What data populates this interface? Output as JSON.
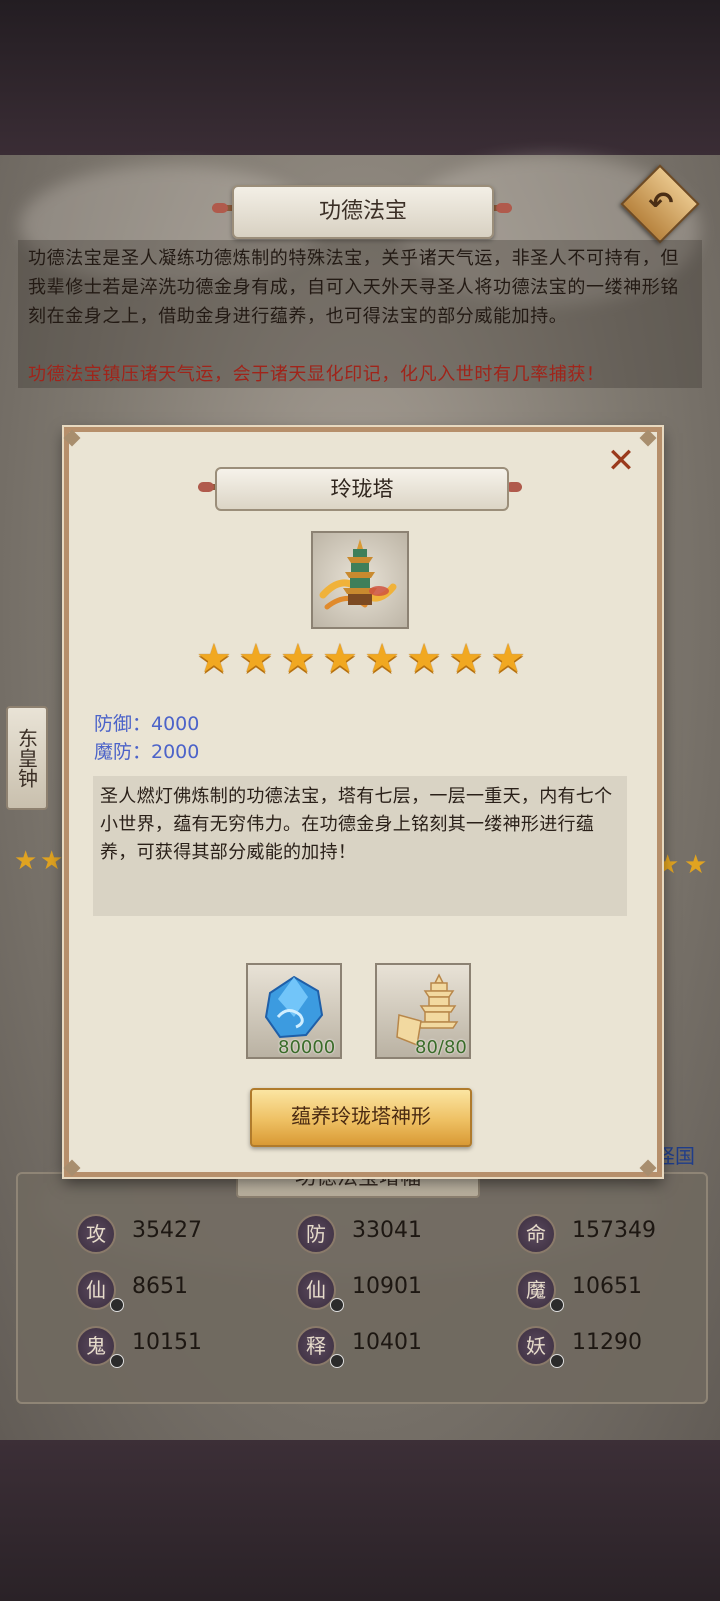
{
  "header": {
    "title": "功德法宝"
  },
  "intro": {
    "paragraph": "功德法宝是圣人凝练功德炼制的特殊法宝，关乎诸天气运，非圣人不可持有，但我辈修士若是淬洗功德金身有成，自可入天外天寻圣人将功德法宝的一缕神形铭刻在金身之上，借助金身进行蕴养，也可得法宝的部分威能加持。",
    "highlight": "功德法宝镇压诸天气运，会于诸天显化印记，化凡入世时有几率捕获！"
  },
  "side_item": {
    "label": "东皇钟"
  },
  "side_link": {
    "label": "怪国"
  },
  "stats": {
    "header": "功德法宝增幅",
    "items": [
      {
        "badge": "攻",
        "value": "35427",
        "dot": false
      },
      {
        "badge": "防",
        "value": "33041",
        "dot": false
      },
      {
        "badge": "命",
        "value": "157349",
        "dot": false
      },
      {
        "badge": "仙",
        "value": "8651",
        "dot": true
      },
      {
        "badge": "仙",
        "value": "10901",
        "dot": true
      },
      {
        "badge": "魔",
        "value": "10651",
        "dot": true
      },
      {
        "badge": "鬼",
        "value": "10151",
        "dot": true
      },
      {
        "badge": "释",
        "value": "10401",
        "dot": true
      },
      {
        "badge": "妖",
        "value": "11290",
        "dot": true
      }
    ]
  },
  "modal": {
    "close_icon": "close-icon",
    "title": "玲珑塔",
    "item_icon": "pagoda-icon",
    "stars": 8,
    "attributes": [
      {
        "label": "防御：4000"
      },
      {
        "label": "魔防：2000"
      }
    ],
    "description": "圣人燃灯佛炼制的功德法宝，塔有七层，一层一重天，内有七个小世界，蕴有无穷伟力。在功德金身上铭刻其一缕神形进行蕴养，可获得其部分威能的加持！",
    "costs": [
      {
        "icon": "blue-crystal-icon",
        "count": "80000"
      },
      {
        "icon": "pagoda-fragment-icon",
        "count": "80/80"
      }
    ],
    "action_button": "蕴养玲珑塔神形"
  }
}
